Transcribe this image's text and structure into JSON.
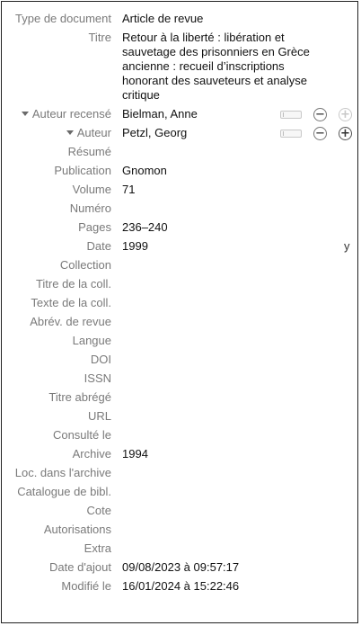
{
  "fields": {
    "item_type": {
      "label": "Type de document",
      "value": "Article de revue"
    },
    "title": {
      "label": "Titre",
      "value": "Retour à la liberté : libération et sauvetage des prisonniers en Grèce ancienne : recueil d’inscriptions honorant des sauveteurs et analyse critique"
    },
    "creators": [
      {
        "label": "Auteur recensé",
        "name": "Bielman, Anne"
      },
      {
        "label": "Auteur",
        "name": "Petzl, Georg"
      }
    ],
    "abstract": {
      "label": "Résumé",
      "value": ""
    },
    "publication": {
      "label": "Publication",
      "value": "Gnomon"
    },
    "volume": {
      "label": "Volume",
      "value": "71"
    },
    "issue": {
      "label": "Numéro",
      "value": ""
    },
    "pages": {
      "label": "Pages",
      "value": "236–240"
    },
    "date": {
      "label": "Date",
      "value": "1999",
      "flag": "y"
    },
    "series": {
      "label": "Collection",
      "value": ""
    },
    "series_title": {
      "label": "Titre de la coll.",
      "value": ""
    },
    "series_text": {
      "label": "Texte de la coll.",
      "value": ""
    },
    "journal_abbr": {
      "label": "Abrév. de revue",
      "value": ""
    },
    "language": {
      "label": "Langue",
      "value": ""
    },
    "doi": {
      "label": "DOI",
      "value": ""
    },
    "issn": {
      "label": "ISSN",
      "value": ""
    },
    "short_title": {
      "label": "Titre abrégé",
      "value": ""
    },
    "url": {
      "label": "URL",
      "value": ""
    },
    "accessed": {
      "label": "Consulté le",
      "value": ""
    },
    "archive": {
      "label": "Archive",
      "value": "1994"
    },
    "archive_loc": {
      "label": "Loc. dans l'archive",
      "value": ""
    },
    "library_catalog": {
      "label": "Catalogue de bibl.",
      "value": ""
    },
    "call_number": {
      "label": "Cote",
      "value": ""
    },
    "rights": {
      "label": "Autorisations",
      "value": ""
    },
    "extra": {
      "label": "Extra",
      "value": ""
    },
    "date_added": {
      "label": "Date d'ajout",
      "value": "09/08/2023 à 09:57:17"
    },
    "modified": {
      "label": "Modifié le",
      "value": "16/01/2024 à 15:22:46"
    }
  },
  "icons": {
    "collapse": "triangle-down-icon",
    "remove": "minus-circle-icon",
    "add": "plus-circle-icon",
    "toggle": "name-mode-switch-icon"
  }
}
